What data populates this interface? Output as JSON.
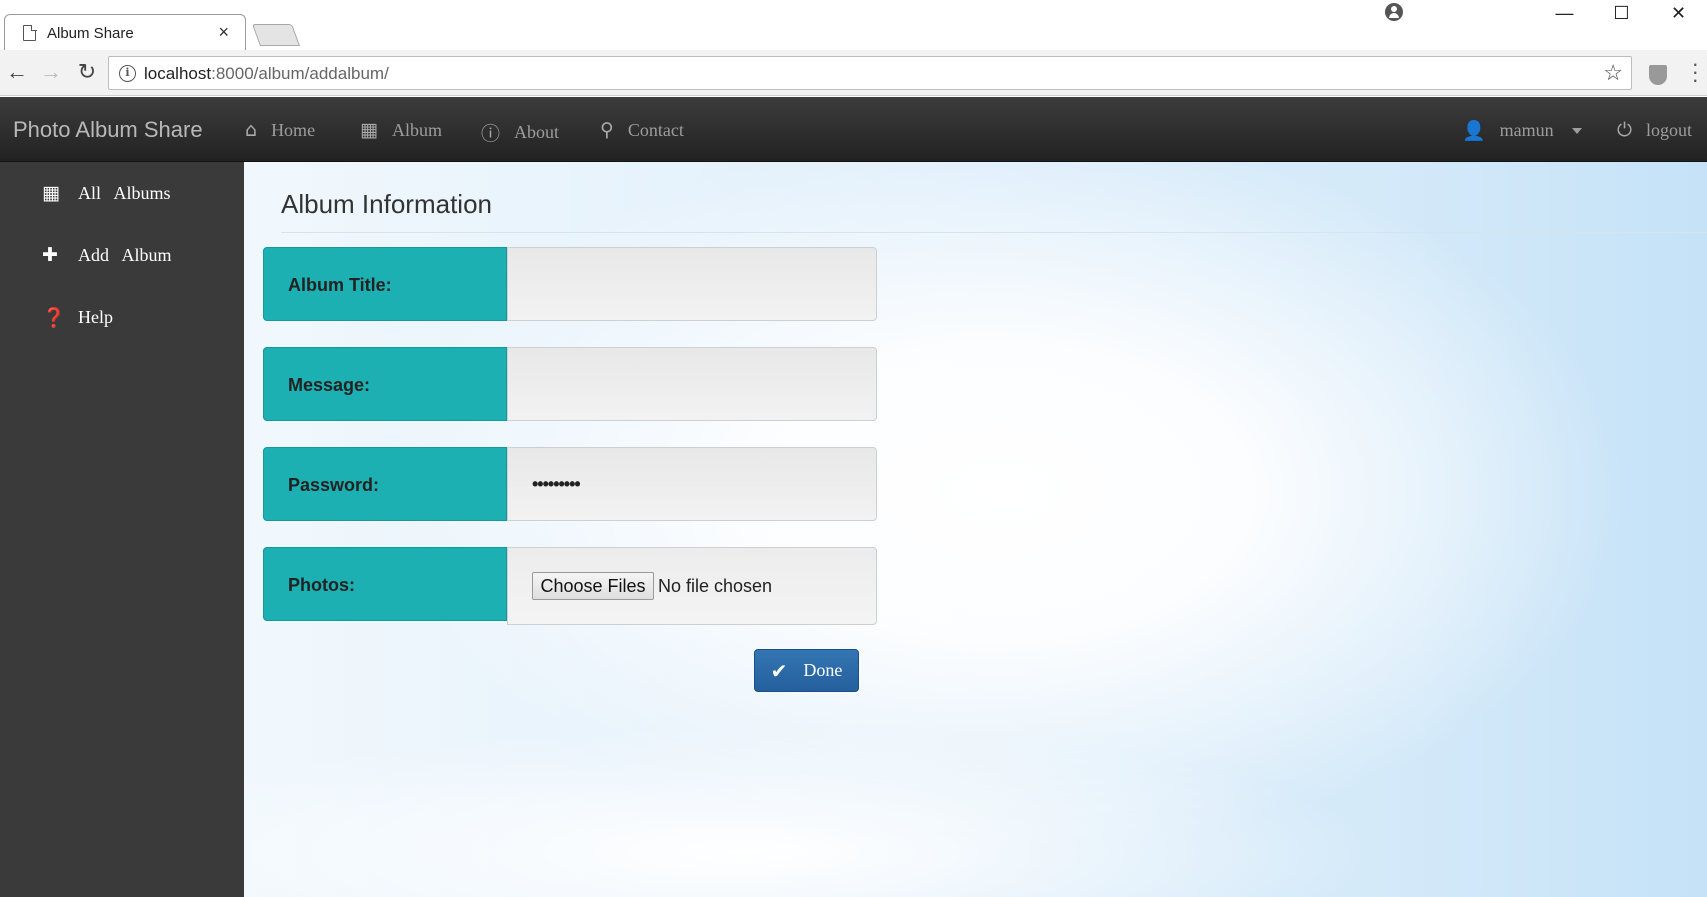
{
  "browser": {
    "tab_title": "Album Share",
    "tab_close": "×",
    "url_host": "localhost",
    "url_rest": ":8000/album/addalbum/",
    "window_buttons": [
      "—",
      "☐",
      "✕"
    ]
  },
  "navbar": {
    "brand": "Photo Album Share",
    "items": [
      {
        "label": "Home",
        "icon": "home-icon"
      },
      {
        "label": "Album",
        "icon": "film-icon"
      },
      {
        "label": "About",
        "icon": "info-icon"
      },
      {
        "label": "Contact",
        "icon": "map-marker-icon"
      }
    ],
    "user": "mamun",
    "logout": "logout"
  },
  "sidebar": {
    "items": [
      {
        "label": "All   Albums",
        "icon": "film-icon"
      },
      {
        "label": "Add   Album",
        "icon": "plus-icon"
      },
      {
        "label": "Help",
        "icon": "question-icon"
      }
    ]
  },
  "main": {
    "title": "Album Information",
    "fields": {
      "title_label": "Album Title:",
      "title_value": "",
      "message_label": "Message:",
      "message_value": "",
      "password_label": "Password:",
      "password_value": "•••••••••",
      "photos_label": "Photos:",
      "choose_files": "Choose Files",
      "no_file": "No file chosen"
    },
    "done_label": "Done"
  },
  "colors": {
    "accent_teal": "#1cb0b3",
    "button_blue": "#2a6aa8",
    "navbar_dark": "#2d2d2d",
    "sidebar_dark": "#3a3a3a"
  }
}
